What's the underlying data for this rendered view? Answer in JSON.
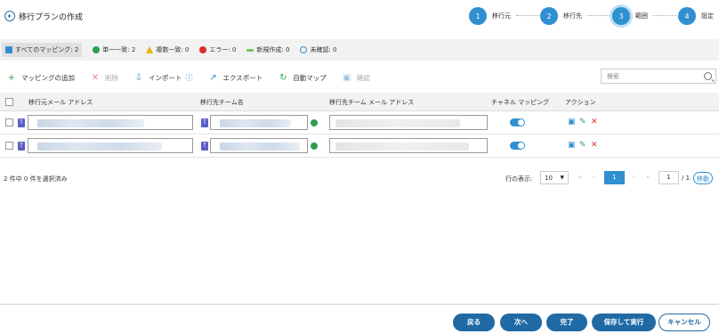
{
  "header": {
    "title": "移行プランの作成",
    "steps": [
      {
        "number": "1",
        "label": "移行元"
      },
      {
        "number": "2",
        "label": "移行先"
      },
      {
        "number": "3",
        "label": "範囲"
      },
      {
        "number": "4",
        "label": "設定"
      }
    ]
  },
  "filters": [
    {
      "label": "すべてのマッピング: 2",
      "icon": "all-mappings-icon"
    },
    {
      "label": "単一一致: 2",
      "icon": "check-circle-icon"
    },
    {
      "label": "複数一致: 0",
      "icon": "warning-icon"
    },
    {
      "label": "エラー: 0",
      "icon": "error-icon"
    },
    {
      "label": "新規作成: 0",
      "icon": "new-icon"
    },
    {
      "label": "未確認: 0",
      "icon": "unconfirmed-icon"
    }
  ],
  "toolbar": {
    "add": "マッピングの追加",
    "delete": "削除",
    "import": "インポート",
    "export": "エクスポート",
    "automap": "自動マップ",
    "confirm": "確認",
    "search_placeholder": "検索"
  },
  "table": {
    "columns": [
      "移行元メール アドレス",
      "移行先チーム名",
      "移行先チーム メール アドレス",
      "チャネル マッピング",
      "アクション"
    ]
  },
  "pager": {
    "selection": "2 件中 0 件を選択済み",
    "rows_label": "行の表示:",
    "rows_value": "10",
    "current_page": "1",
    "page_input": "1",
    "total": "/ 1",
    "go": "移動"
  },
  "footer": {
    "back": "戻る",
    "next": "次へ",
    "finish": "完了",
    "save_run": "保存して実行",
    "cancel": "キャンセル"
  },
  "colors": {
    "accent": "#2f8fd0",
    "button": "#1f6aa5",
    "success": "#2e9e4f",
    "error": "#d9302c"
  }
}
